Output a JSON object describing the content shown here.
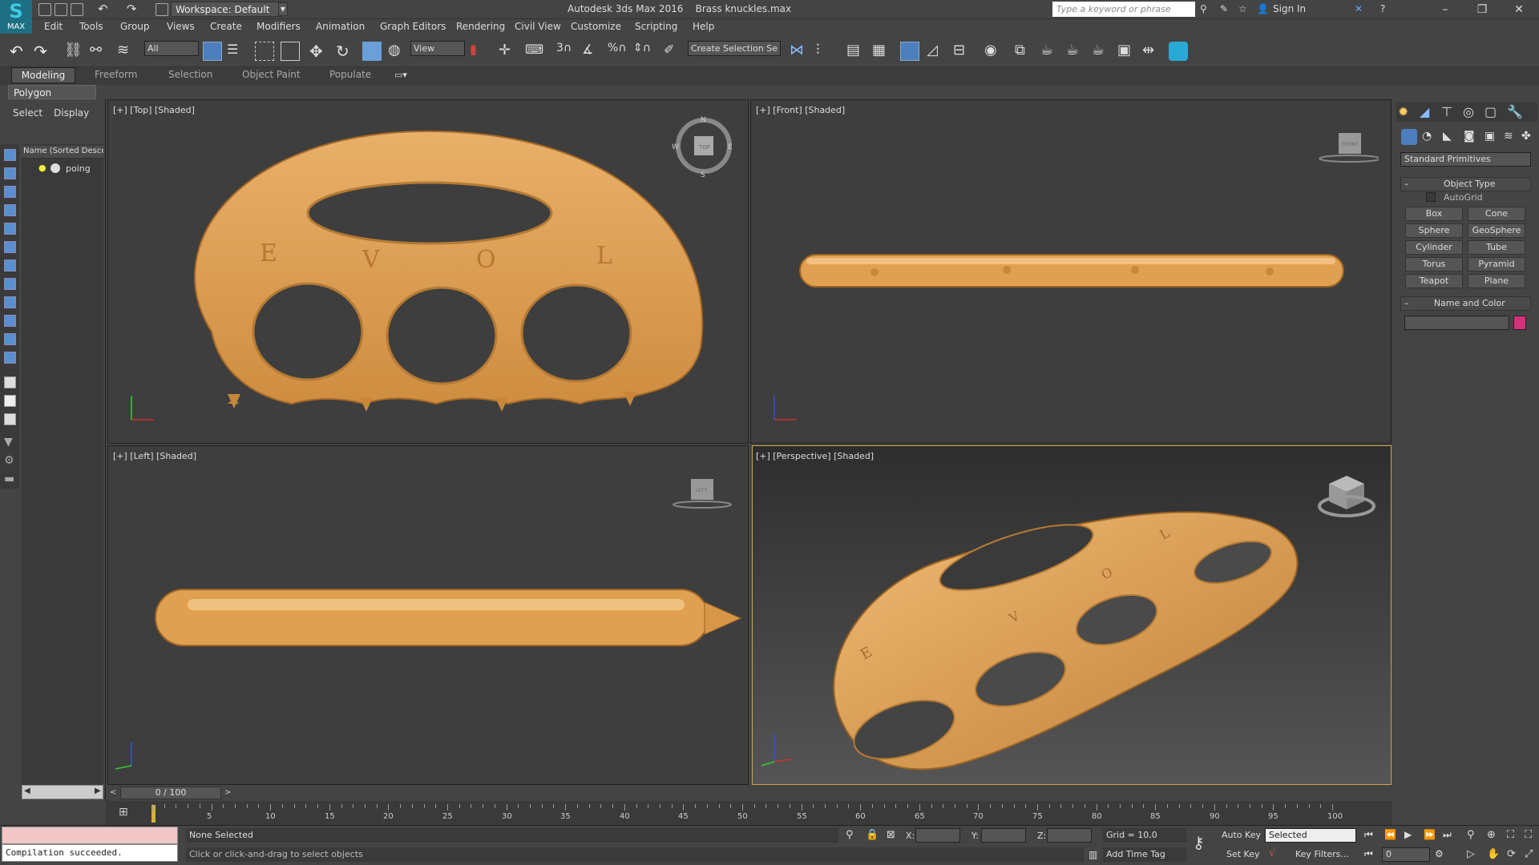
{
  "titlebar": {
    "logo_label": "MAX",
    "workspace": "Workspace: Default",
    "app_title": "Autodesk 3ds Max 2016",
    "file_name": "Brass knuckles.max",
    "search_placeholder": "Type a keyword or phrase",
    "sign_in": "Sign In"
  },
  "menu": [
    "Edit",
    "Tools",
    "Group",
    "Views",
    "Create",
    "Modifiers",
    "Animation",
    "Graph Editors",
    "Rendering",
    "Civil View",
    "Customize",
    "Scripting",
    "Help"
  ],
  "toolbar": {
    "selection_filter": "All",
    "reference_coord": "View",
    "selection_set": "Create Selection Se"
  },
  "ribbon": {
    "tabs": [
      "Modeling",
      "Freeform",
      "Selection",
      "Object Paint",
      "Populate"
    ],
    "panel": "Polygon Modeling"
  },
  "explorer": {
    "tabs": [
      "Select",
      "Display"
    ],
    "column_header": "Name (Sorted Desce",
    "objects": [
      "poing"
    ]
  },
  "viewports": {
    "top": "[+] [Top] [Shaded]",
    "front": "[+] [Front] [Shaded]",
    "left": "[+] [Left] [Shaded]",
    "perspective": "[+] [Perspective] [Shaded]"
  },
  "viewcube": {
    "top_face": "TOP",
    "front_face": "FRONT",
    "left_face": "LEFT",
    "compass": [
      "N",
      "E",
      "S",
      "W"
    ]
  },
  "engraving": [
    "E",
    "V",
    "O",
    "L"
  ],
  "command_panel": {
    "category": "Standard Primitives",
    "object_type_title": "Object Type",
    "autogrid": "AutoGrid",
    "buttons": [
      "Box",
      "Cone",
      "Sphere",
      "GeoSphere",
      "Cylinder",
      "Tube",
      "Torus",
      "Pyramid",
      "Teapot",
      "Plane"
    ],
    "name_color_title": "Name and Color",
    "color": "#d4307a"
  },
  "timeline": {
    "frame": "0 / 100",
    "ticks": [
      "5",
      "10",
      "15",
      "20",
      "25",
      "30",
      "35",
      "40",
      "45",
      "50",
      "55",
      "60",
      "65",
      "70",
      "75",
      "80",
      "85",
      "90",
      "95",
      "100"
    ]
  },
  "status": {
    "maxscript_output": "Compilation succeeded.",
    "selection": "None Selected",
    "prompt": "Click or click-and-drag to select objects",
    "x_label": "X:",
    "y_label": "Y:",
    "z_label": "Z:",
    "grid": "Grid = 10,0",
    "add_time_tag": "Add Time Tag",
    "auto_key": "Auto Key",
    "set_key": "Set Key",
    "key_mode": "Selected",
    "key_filters": "Key Filters...",
    "current_frame": "0"
  },
  "colors": {
    "object": "#e0a052",
    "viewport_bg": "#3e3e3e",
    "accent": "#d4307a"
  }
}
